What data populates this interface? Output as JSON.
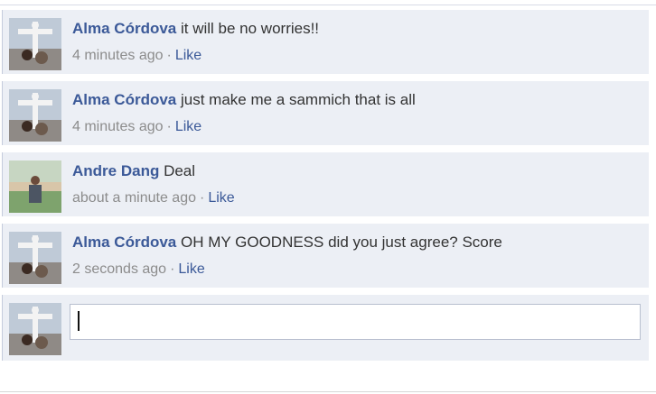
{
  "comments": [
    {
      "author": "Alma Córdova",
      "text": "it will be no worries!!",
      "time": "4 minutes ago",
      "like": "Like"
    },
    {
      "author": "Alma Córdova",
      "text": "just make me a sammich that is all",
      "time": "4 minutes ago",
      "like": "Like"
    },
    {
      "author": "Andre Dang",
      "text": "Deal",
      "time": "about a minute ago",
      "like": "Like"
    },
    {
      "author": "Alma Córdova",
      "text": "OH MY GOODNESS did you just agree? Score",
      "time": "2 seconds ago",
      "like": "Like"
    }
  ],
  "reply_box": {
    "value": ""
  },
  "colors": {
    "link": "#3b5998",
    "comment_bg": "#eceff5",
    "meta": "#8c8c8c"
  }
}
